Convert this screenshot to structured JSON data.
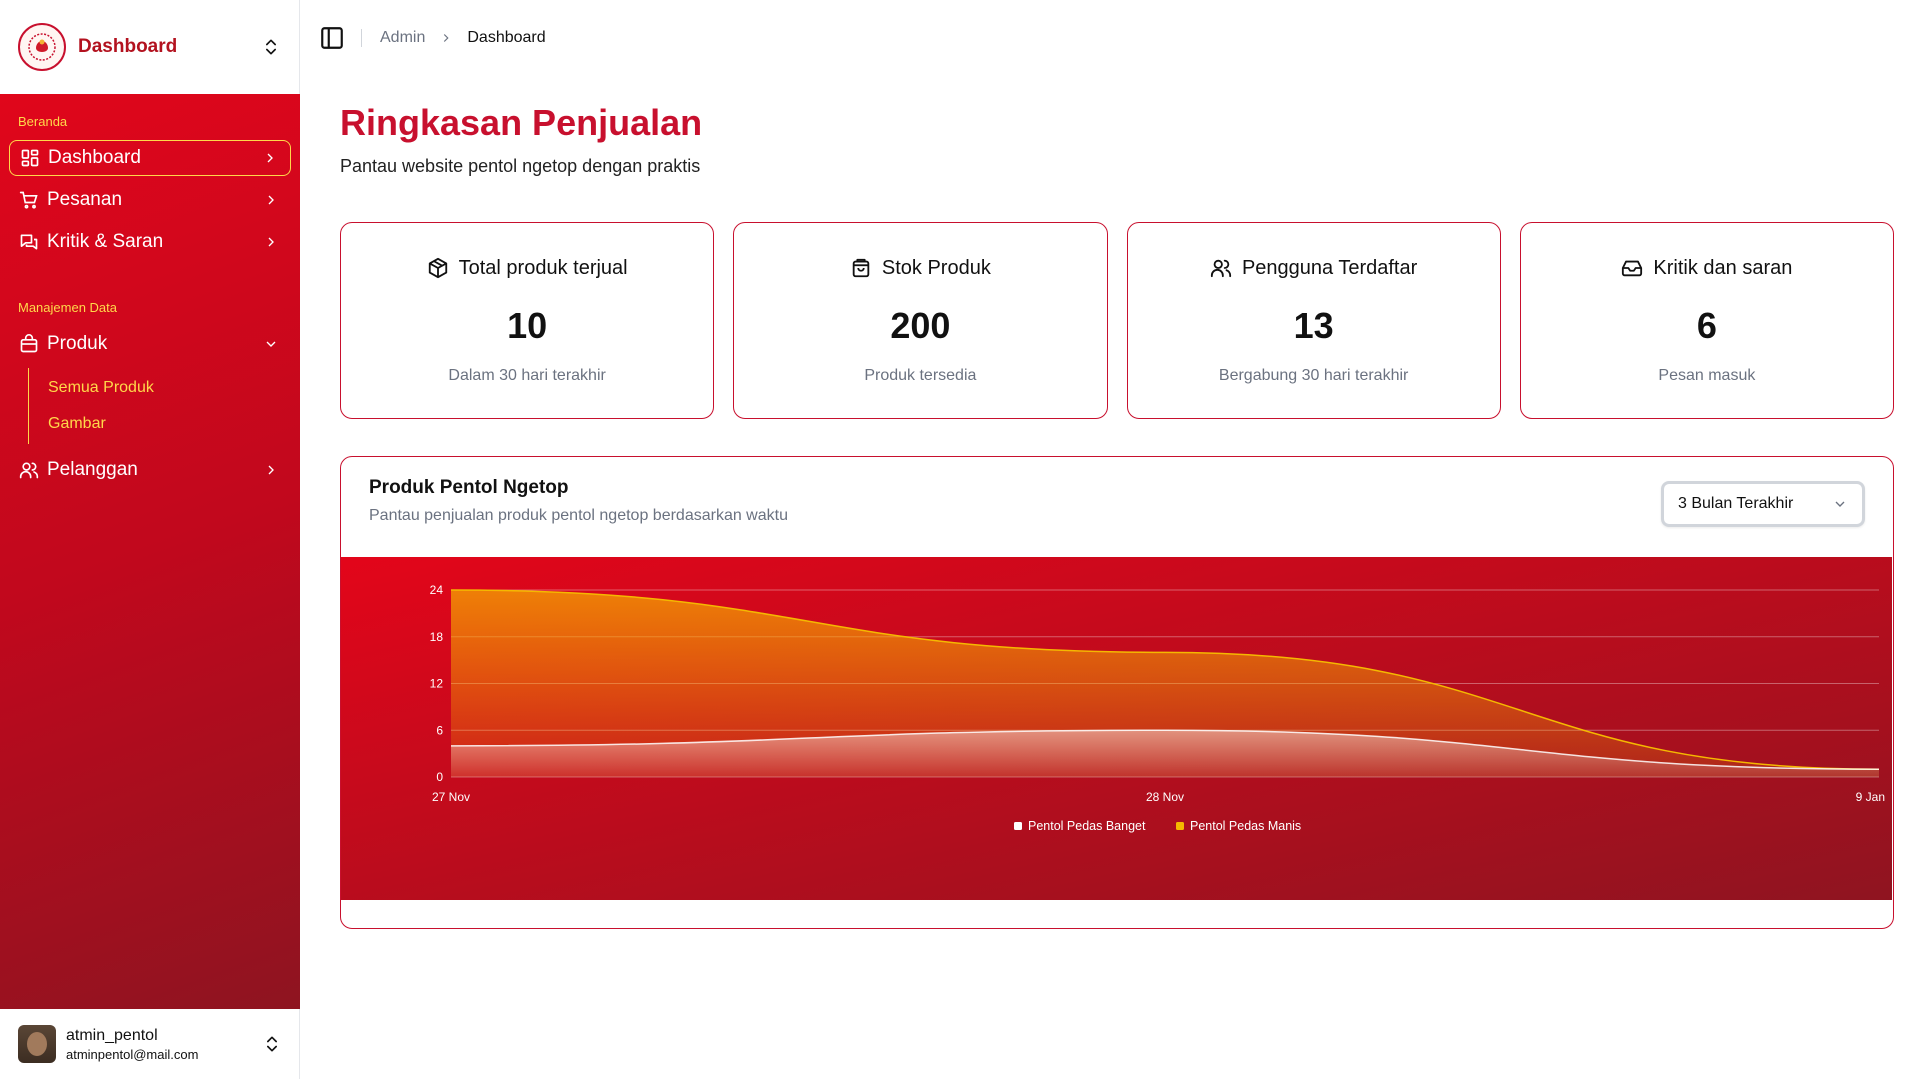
{
  "sidebar": {
    "title": "Dashboard",
    "sections": [
      {
        "label": "Beranda"
      },
      {
        "label": "Manajemen Data"
      }
    ],
    "items": {
      "dashboard": "Dashboard",
      "pesanan": "Pesanan",
      "kritik": "Kritik & Saran",
      "produk": "Produk",
      "semua_produk": "Semua Produk",
      "gambar": "Gambar",
      "pelanggan": "Pelanggan"
    },
    "user": {
      "name": "atmin_pentol",
      "email": "atminpentol@mail.com"
    }
  },
  "breadcrumb": {
    "root": "Admin",
    "current": "Dashboard"
  },
  "page": {
    "title": "Ringkasan Penjualan",
    "subtitle": "Pantau website pentol ngetop dengan praktis"
  },
  "cards": [
    {
      "title": "Total produk terjual",
      "value": "10",
      "note": "Dalam 30 hari terakhir",
      "icon": "package-icon"
    },
    {
      "title": "Stok Produk",
      "value": "200",
      "note": "Produk tersedia",
      "icon": "shopping-bag-icon"
    },
    {
      "title": "Pengguna Terdaftar",
      "value": "13",
      "note": "Bergabung 30 hari terakhir",
      "icon": "users-icon"
    },
    {
      "title": "Kritik dan saran",
      "value": "6",
      "note": "Pesan masuk",
      "icon": "inbox-icon"
    }
  ],
  "chart_card": {
    "title": "Produk Pentol Ngetop",
    "subtitle": "Pantau penjualan produk pentol ngetop berdasarkan waktu",
    "range_select": "3 Bulan Terakhir"
  },
  "chart_data": {
    "type": "area",
    "x": [
      "27 Nov",
      "28 Nov",
      "9 Jan"
    ],
    "y_ticks": [
      0,
      6,
      12,
      18,
      24
    ],
    "ylim": [
      0,
      24
    ],
    "grid": true,
    "legend_position": "bottom-center",
    "series": [
      {
        "name": "Pentol Pedas Banget",
        "values": [
          4,
          6,
          1
        ],
        "color": "#ffffff"
      },
      {
        "name": "Pentol Pedas Manis",
        "values": [
          24,
          16,
          1
        ],
        "color": "#f5b800"
      }
    ],
    "background": {
      "from": "#e3051a",
      "to": "#8f1420"
    }
  }
}
